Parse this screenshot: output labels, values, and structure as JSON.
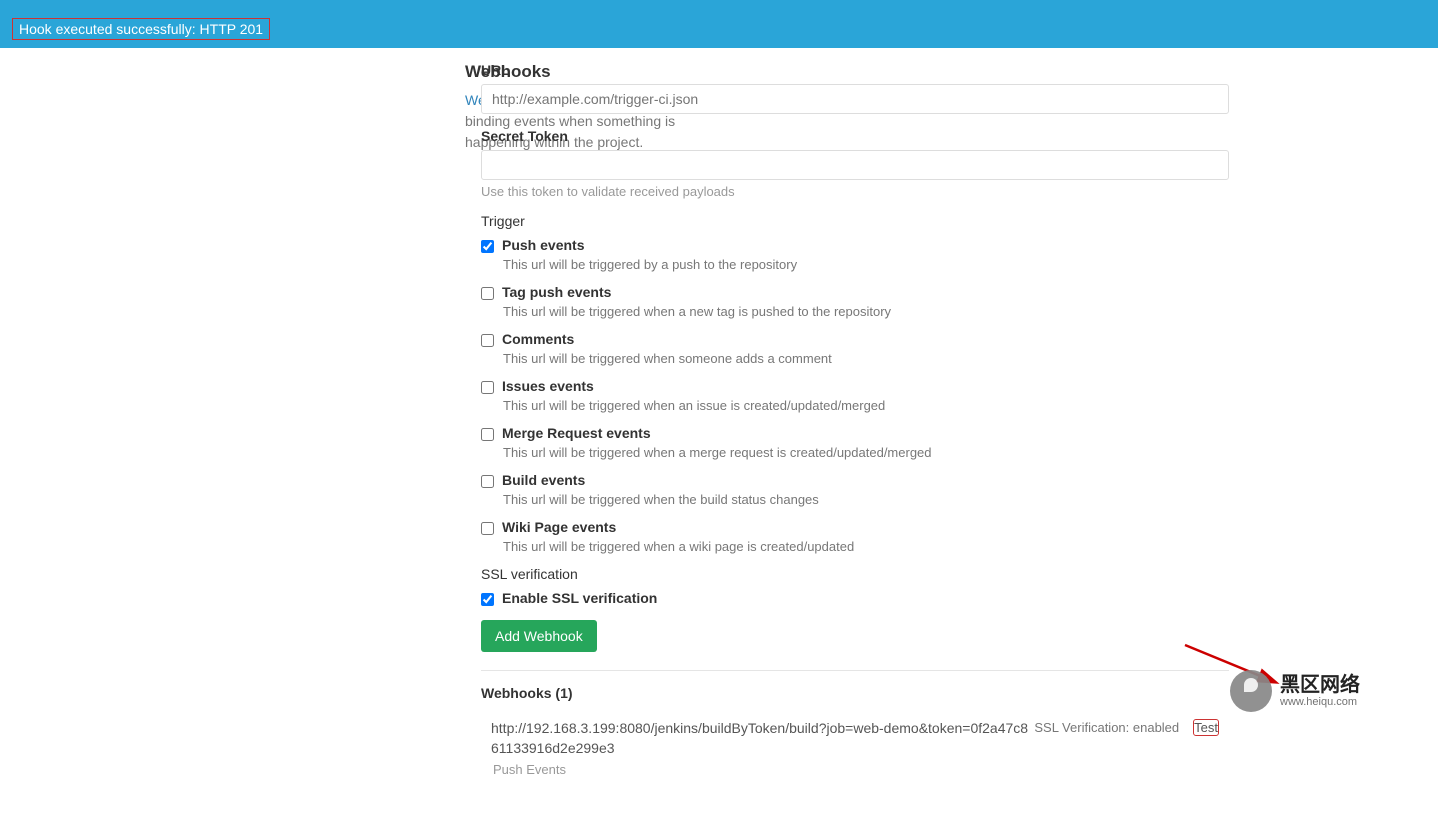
{
  "flash": {
    "message": "Hook executed successfully: HTTP 201"
  },
  "sidebar": {
    "title": "Webhooks",
    "link_text": "Webhooks",
    "desc_rest": " can be used for binding events when something is happening within the project."
  },
  "form": {
    "url_label": "URL",
    "url_placeholder": "http://example.com/trigger-ci.json",
    "secret_label": "Secret Token",
    "secret_help": "Use this token to validate received payloads",
    "trigger_label": "Trigger",
    "triggers": [
      {
        "label": "Push events",
        "desc": "This url will be triggered by a push to the repository",
        "checked": true
      },
      {
        "label": "Tag push events",
        "desc": "This url will be triggered when a new tag is pushed to the repository",
        "checked": false
      },
      {
        "label": "Comments",
        "desc": "This url will be triggered when someone adds a comment",
        "checked": false
      },
      {
        "label": "Issues events",
        "desc": "This url will be triggered when an issue is created/updated/merged",
        "checked": false
      },
      {
        "label": "Merge Request events",
        "desc": "This url will be triggered when a merge request is created/updated/merged",
        "checked": false
      },
      {
        "label": "Build events",
        "desc": "This url will be triggered when the build status changes",
        "checked": false
      },
      {
        "label": "Wiki Page events",
        "desc": "This url will be triggered when a wiki page is created/updated",
        "checked": false
      }
    ],
    "ssl_section": "SSL verification",
    "ssl_enable": "Enable SSL verification",
    "ssl_checked": true,
    "submit": "Add Webhook"
  },
  "list": {
    "title": "Webhooks (1)",
    "items": [
      {
        "url": "http://192.168.3.199:8080/jenkins/buildByToken/build?job=web-demo&token=0f2a47c861133916d2e299e3",
        "tag": "Push Events",
        "ssl": "SSL Verification: enabled",
        "test": "Test"
      }
    ]
  },
  "watermark": {
    "cn": "黑区网络",
    "url": "www.heiqu.com"
  }
}
